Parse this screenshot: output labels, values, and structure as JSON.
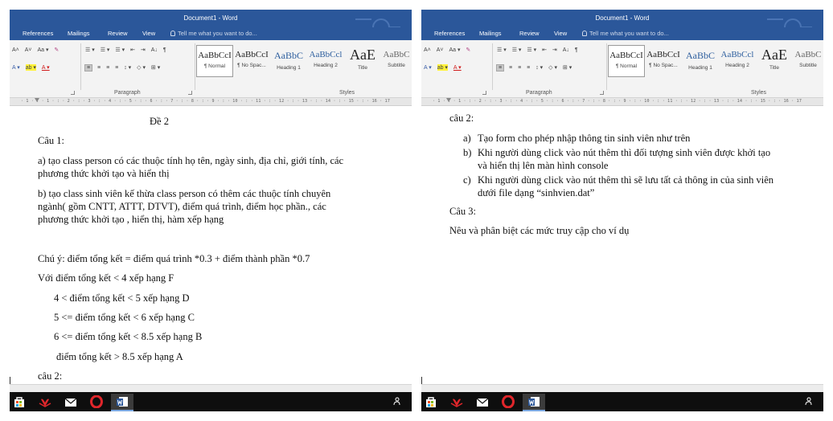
{
  "window": {
    "title": "Document1 - Word"
  },
  "tabs": [
    "References",
    "Mailings",
    "Review",
    "View"
  ],
  "tell_me": "Tell me what you want to do...",
  "ribbon": {
    "font_group_row1": [
      "A˄",
      "A˅",
      "Aa ▾",
      "✎"
    ],
    "font_group_row2": [
      "A ▾",
      "ab ▾",
      "A ▾"
    ],
    "para_row1": [
      "☰ ▾",
      "☰ ▾",
      "☰ ▾",
      "⇤",
      "⇥",
      "A↓",
      "¶"
    ],
    "para_row2": [
      "≡",
      "≡",
      "≡",
      "≡",
      "↕ ▾",
      "◇ ▾",
      "⊞ ▾"
    ],
    "paragraph_label": "Paragraph",
    "styles_label": "Styles"
  },
  "left_styles": [
    {
      "sample": "AaBbCcI",
      "name": "¶ Normal"
    },
    {
      "sample": "AaBbCcI",
      "name": "¶ No Spac..."
    },
    {
      "sample": "AaBbC",
      "name": "Heading 1"
    },
    {
      "sample": "AaBbCcl",
      "name": "Heading 2"
    },
    {
      "sample": "AaE",
      "name": "Title"
    },
    {
      "sample": "AaBbC",
      "name": "Subtitle"
    }
  ],
  "right_styles": [
    {
      "sample": "AaBbCcI",
      "name": "¶ Normal"
    },
    {
      "sample": "AaBbCcI",
      "name": "¶ No Spac..."
    },
    {
      "sample": "AaBbC",
      "name": "Heading 1"
    },
    {
      "sample": "AaBbCcl",
      "name": "Heading 2"
    },
    {
      "sample": "AaE",
      "name": "Title"
    },
    {
      "sample": "AaBbC",
      "name": "Subtitle"
    }
  ],
  "ruler_text": "· 1 · : · 1 · : · 2 · : · 3 · : · 4 · : · 5 · : · 6 · : · 7 · : · 8 · : · 9 · : · 10 · : · 11 · : · 12 · : · 13 · : · 14 · : · 15 · : · 16 · 17",
  "left_doc": {
    "heading": "Đề 2",
    "cau1": "Câu 1:",
    "a1": "a)  tạo class person có các thuộc tính họ tên, ngày sinh, địa chỉ, giới tính, các",
    "a2": "phương thức khởi tạo và hiển thị",
    "b1": "b)  tạo class sinh viên kế thừa class person có thêm các thuộc tính chuyên",
    "b2": "ngành( gồm CNTT, ATTT, DTVT), điểm quá trình, điểm học phần., các",
    "b3": "phương thức khởi tạo , hiển thị, hàm xếp hạng",
    "note": "Chú ý: điểm tổng kết = điểm quá trình *0.3 + điểm thành phần *0.7",
    "r1": "Với điểm tổng kết < 4 xếp hạng F",
    "r2": "4 < điểm tổng kết < 5 xếp hạng D",
    "r3": "5 <= điểm tổng kết < 6 xếp hạng C",
    "r4": "6 <= điểm tổng kết < 8.5 xếp hạng B",
    "r5": "điểm tổng kết > 8.5 xếp hạng A",
    "cau2": "câu 2:"
  },
  "right_doc": {
    "cau2": "câu 2:",
    "a_mark": "a)",
    "a": "Tạo form cho phép nhập thông tin sinh viên như trên",
    "b_mark": "b)",
    "b1": "Khi người dùng click vào nút thêm thì đối tượng sinh viên được khởi tạo",
    "b2": "và hiển thị lên màn hình console",
    "c_mark": "c)",
    "c1": "Khi người dùng click vào nút thêm thì sẽ lưu tất cả thông in của sinh viên",
    "c2": "dưới file dạng “sinhvien.dat”",
    "cau3": "Câu 3:",
    "q3": "Nêu và phân biệt các mức truy cập cho ví dụ"
  },
  "colors": {
    "word_blue": "#2b579a",
    "taskbar": "#0e0e0e",
    "opera_red": "#e0262b"
  },
  "taskbar_icons": [
    "store-icon",
    "huawei-icon",
    "mail-icon",
    "opera-icon",
    "word-icon"
  ]
}
